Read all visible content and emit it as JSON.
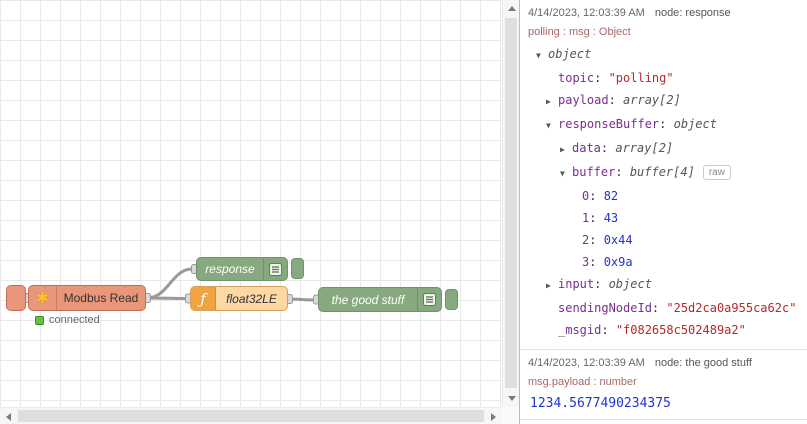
{
  "colors": {
    "modbus_node": "#e9967a",
    "debug_node": "#87a980",
    "function_node_body": "#fdd7a4",
    "function_node_icon": "#efa440",
    "status_connected": "#6abf4b",
    "wire": "#999999",
    "debug_key": "#792e90",
    "debug_string": "#b72828",
    "debug_number": "#2033d6",
    "debug_topic": "#aa6666"
  },
  "icons": {
    "modbus-icon": "✱",
    "function-icon": "ƒ",
    "collapse-icon": "▼",
    "expand-icon": "▶",
    "debug-list-icon": "≡"
  },
  "canvas": {
    "modbus": {
      "label": "Modbus Read",
      "icon": "✱",
      "status": "connected"
    },
    "response": {
      "label": "response"
    },
    "func": {
      "label": "float32LE",
      "icon": "ƒ"
    },
    "goodstuff": {
      "label": "the good stuff"
    }
  },
  "debug": {
    "msg1": {
      "timestamp": "4/14/2023, 12:03:39 AM",
      "node": "node: response",
      "topic": "polling : msg : Object",
      "raw_button": "raw",
      "rows": [
        {
          "key": "object",
          "value": ""
        },
        {
          "key": "topic",
          "value": "\"polling\""
        },
        {
          "key": "payload",
          "value": "array[2]"
        },
        {
          "key": "responseBuffer",
          "value": "object"
        },
        {
          "key": "data",
          "value": "array[2]"
        },
        {
          "key": "buffer",
          "value": "buffer[4]"
        },
        {
          "key": "0",
          "value": "82"
        },
        {
          "key": "1",
          "value": "43"
        },
        {
          "key": "2",
          "value": "0x44"
        },
        {
          "key": "3",
          "value": "0x9a"
        },
        {
          "key": "input",
          "value": "object"
        },
        {
          "key": "sendingNodeId",
          "value": "\"25d2ca0a955ca62c\""
        },
        {
          "key": "_msgid",
          "value": "\"f082658c502489a2\""
        }
      ]
    },
    "msg2": {
      "timestamp": "4/14/2023, 12:03:39 AM",
      "node": "node: the good stuff",
      "topic": "msg.payload : number",
      "value": "1234.5677490234375"
    }
  }
}
